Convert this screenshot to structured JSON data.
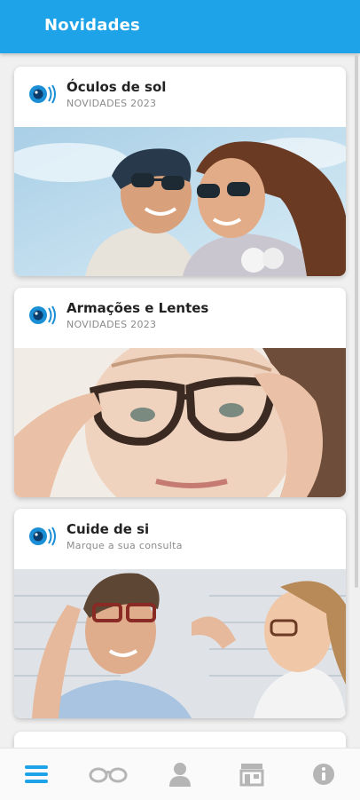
{
  "header": {
    "title": "Novidades"
  },
  "cards": [
    {
      "title": "Óculos de sol",
      "subtitle": "NOVIDADES 2023",
      "image": "couple-sunglasses-photo"
    },
    {
      "title": "Armações e Lentes",
      "subtitle": "NOVIDADES 2023",
      "image": "woman-frames-photo"
    },
    {
      "title": "Cuide de si",
      "subtitle": "Marque a sua consulta",
      "image": "optician-fitting-photo"
    }
  ],
  "bottom_nav": {
    "items": [
      {
        "icon": "menu-icon",
        "active": true
      },
      {
        "icon": "glasses-icon",
        "active": false
      },
      {
        "icon": "person-icon",
        "active": false
      },
      {
        "icon": "store-icon",
        "active": false
      },
      {
        "icon": "info-icon",
        "active": false
      }
    ]
  },
  "colors": {
    "primary": "#1ea3e8",
    "inactive_icon": "#b5b5b5"
  }
}
